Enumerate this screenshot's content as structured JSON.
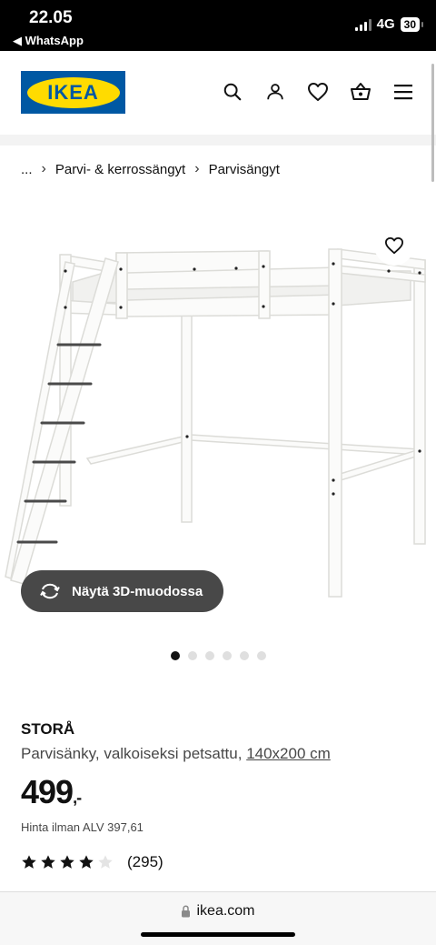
{
  "status_bar": {
    "time": "22.05",
    "back_app": "◀ WhatsApp",
    "network": "4G",
    "battery": "30"
  },
  "header": {
    "logo_text": "IKEA",
    "icons": [
      "search-icon",
      "user-icon",
      "heart-icon",
      "shopping-basket-icon",
      "menu-icon"
    ]
  },
  "breadcrumb": {
    "ellipsis": "...",
    "items": [
      "Parvi- & kerrossängyt",
      "Parvisängyt"
    ]
  },
  "gallery": {
    "view_3d_label": "Näytä 3D-muodossa",
    "dot_count": 6,
    "active_index": 0
  },
  "product": {
    "name": "STORÅ",
    "description": "Parvisänky, valkoiseksi petsattu, ",
    "size": "140x200 cm",
    "price": "499",
    "price_suffix": ",-",
    "vat_text": "Hinta ilman ALV 397,61",
    "rating": 4,
    "rating_max": 5,
    "review_count": "(295)"
  },
  "browser": {
    "url": "ikea.com"
  },
  "colors": {
    "brand_blue": "#0058a3",
    "brand_yellow": "#ffdb00",
    "button_dark": "#484848"
  }
}
